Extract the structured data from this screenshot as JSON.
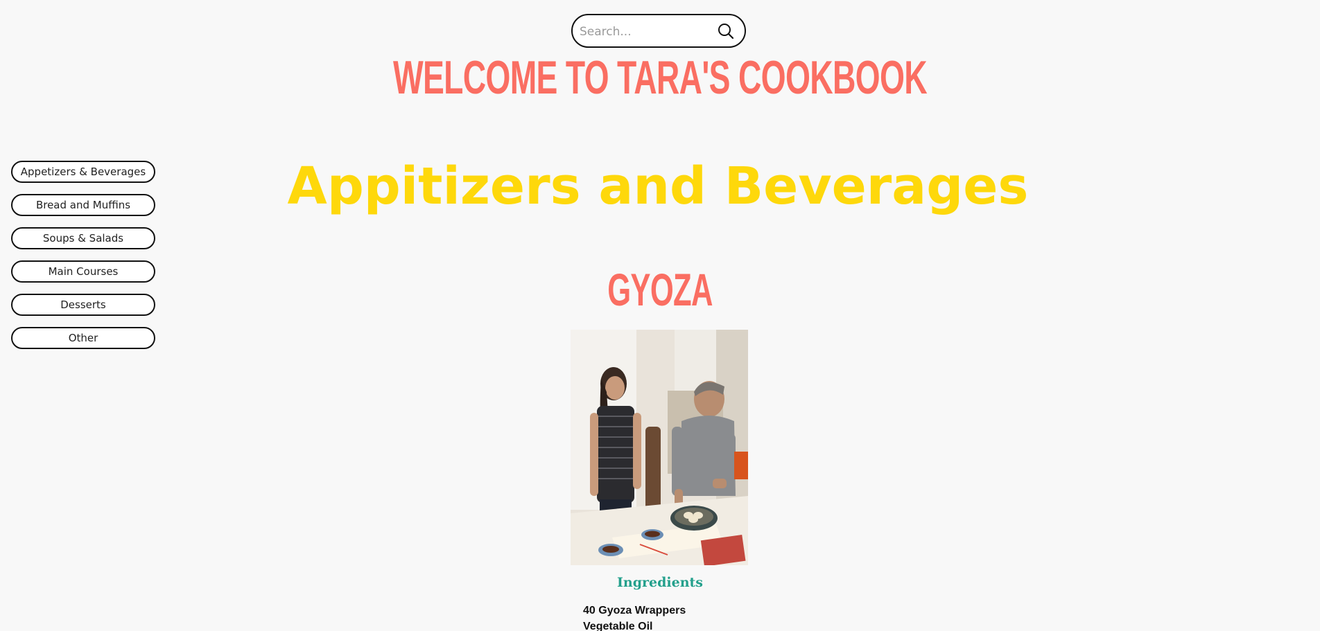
{
  "search": {
    "placeholder": "Search...",
    "icon": "search-icon"
  },
  "site": {
    "title": "WELCOME TO TARA'S COOKBOOK"
  },
  "sidebar": {
    "items": [
      {
        "label": "Appetizers & Beverages"
      },
      {
        "label": "Bread and Muffins"
      },
      {
        "label": "Soups & Salads"
      },
      {
        "label": "Main Courses"
      },
      {
        "label": "Desserts"
      },
      {
        "label": "Other"
      }
    ]
  },
  "section": {
    "title": "Appitizers and Beverages"
  },
  "recipe": {
    "title": "GYOZA",
    "photo_icon": "recipe-photo",
    "ingredients_heading": "Ingredients",
    "ingredients": [
      "40 Gyoza Wrappers",
      "Vegetable Oil"
    ]
  },
  "colors": {
    "background": "#f8f8f8",
    "title_coral": "#fa6e62",
    "section_yellow": "#fed80b",
    "ingredients_teal": "#23a08c"
  }
}
